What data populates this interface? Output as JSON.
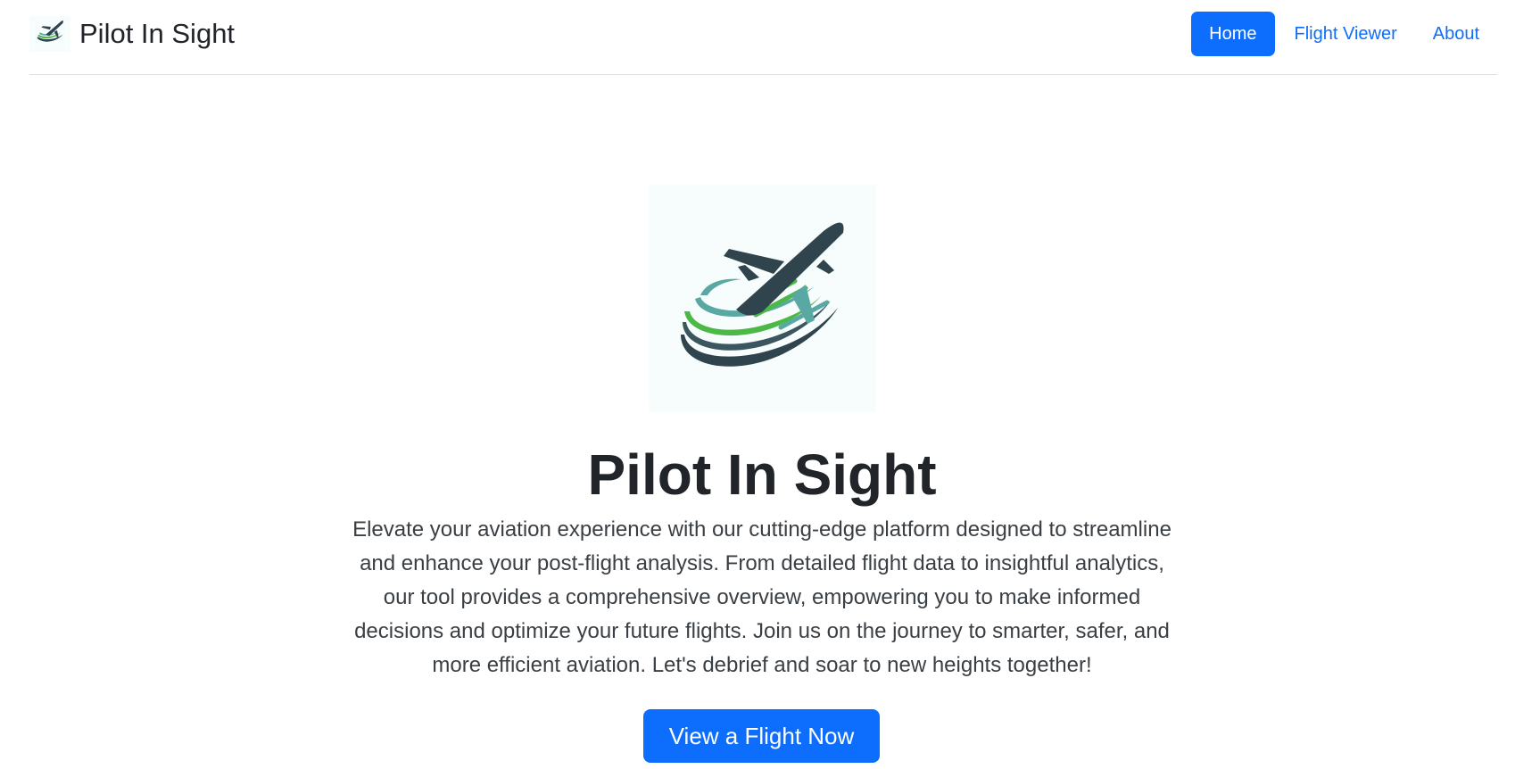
{
  "navbar": {
    "brand": "Pilot In Sight",
    "brand_logo_icon": "airplane-logo-icon",
    "links": [
      {
        "label": "Home",
        "active": true
      },
      {
        "label": "Flight Viewer",
        "active": false
      },
      {
        "label": "About",
        "active": false
      }
    ]
  },
  "hero": {
    "logo_icon": "airplane-logo-icon",
    "title": "Pilot In Sight",
    "description": "Elevate your aviation experience with our cutting-edge platform designed to streamline and enhance your post-flight analysis. From detailed flight data to insightful analytics, our tool provides a comprehensive overview, empowering you to make informed decisions and optimize your future flights. Join us on the journey to smarter, safer, and more efficient aviation. Let's debrief and soar to new heights together!",
    "cta_label": "View a Flight Now"
  },
  "colors": {
    "primary": "#0d6efd",
    "logo_dark": "#2f444c",
    "logo_green": "#4cb848",
    "logo_teal": "#5aa8a4"
  }
}
